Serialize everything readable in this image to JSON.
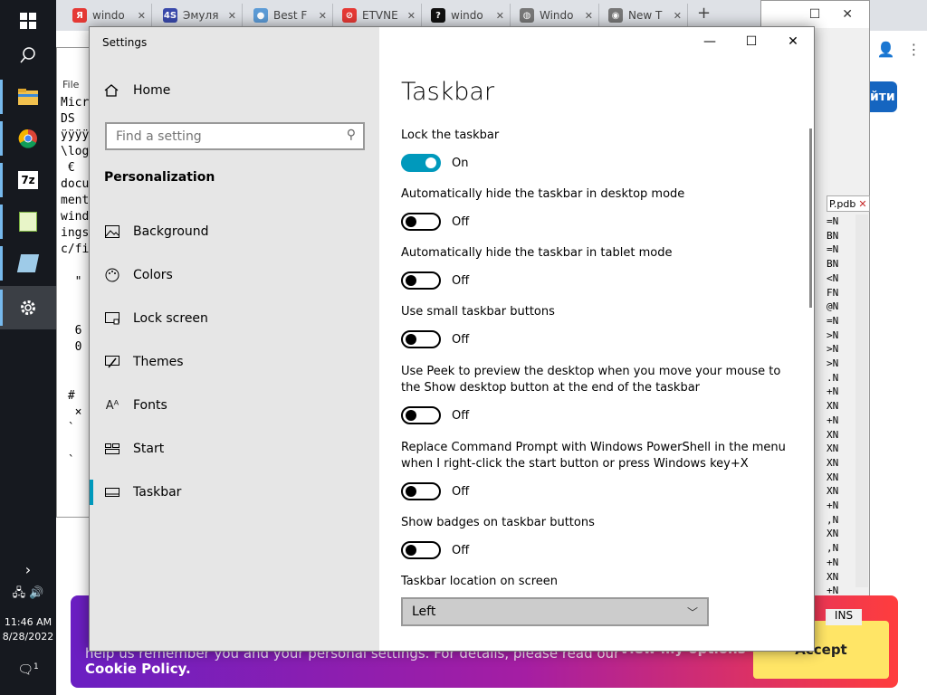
{
  "taskbar": {
    "time": "11:46 AM",
    "date": "8/28/2022",
    "notification_count": "1"
  },
  "browser": {
    "tabs": [
      {
        "label": "windo",
        "favicon": "Я",
        "color": "#e53935"
      },
      {
        "label": "Эмуля",
        "favicon": "4S",
        "color": "#3949ab"
      },
      {
        "label": "Best F",
        "favicon": "●",
        "color": "#5c9bd6"
      },
      {
        "label": "ETVNE",
        "favicon": "⊘",
        "color": "#e53935"
      },
      {
        "label": "windo",
        "favicon": "?",
        "color": "#111111"
      },
      {
        "label": "Windo",
        "favicon": "◍",
        "color": "#777777"
      },
      {
        "label": "New T",
        "favicon": "◉",
        "color": "#777777"
      }
    ],
    "new_tab": "+",
    "enter_button": "йти",
    "cookie": {
      "text": "help us remember you and your personal settings. For details, please read our",
      "link": "Cookie Policy.",
      "view_options": "View my options",
      "accept": "Accept"
    }
  },
  "notepad": {
    "menu": "File",
    "text_lines": [
      "Micr",
      "DS",
      "ÿÿÿÿ",
      "\\log",
      " €",
      "docu",
      "ment",
      "wind",
      "ings",
      "c/fi",
      "  ",
      "  \"",
      "",
      "  ",
      "  6",
      "  0",
      "",
      "  ",
      " #",
      "  ×",
      " `",
      "  ",
      " `"
    ]
  },
  "right_window": {
    "pdb_tab": "P.pdb",
    "hex_rows": [
      "=N",
      "BN",
      "=N",
      "BN",
      "<N",
      "FN",
      "@N",
      "=N",
      ">N",
      ">N",
      ">N",
      ".N",
      "+N",
      "XN",
      "+N",
      "XN",
      "XN",
      "XN",
      "XN",
      "XN",
      "+N",
      ",N",
      "XN",
      ",N",
      "+N",
      "XN",
      "+N"
    ],
    "status": "INS"
  },
  "settings": {
    "window_title": "Settings",
    "home": "Home",
    "search_placeholder": "Find a setting",
    "section": "Personalization",
    "nav": [
      {
        "label": "Background",
        "icon": "picture-icon"
      },
      {
        "label": "Colors",
        "icon": "palette-icon"
      },
      {
        "label": "Lock screen",
        "icon": "lock-screen-icon"
      },
      {
        "label": "Themes",
        "icon": "themes-icon"
      },
      {
        "label": "Fonts",
        "icon": "fonts-icon"
      },
      {
        "label": "Start",
        "icon": "start-icon"
      },
      {
        "label": "Taskbar",
        "icon": "taskbar-icon",
        "active": true
      }
    ],
    "page_title": "Taskbar",
    "options": [
      {
        "label": "Lock the taskbar",
        "state": "On",
        "on": true
      },
      {
        "label": "Automatically hide the taskbar in desktop mode",
        "state": "Off",
        "on": false
      },
      {
        "label": "Automatically hide the taskbar in tablet mode",
        "state": "Off",
        "on": false
      },
      {
        "label": "Use small taskbar buttons",
        "state": "Off",
        "on": false
      },
      {
        "label": "Use Peek to preview the desktop when you move your mouse to the Show desktop button at the end of the taskbar",
        "state": "Off",
        "on": false
      },
      {
        "label": "Replace Command Prompt with Windows PowerShell in the menu when I right-click the start button or press Windows key+X",
        "state": "Off",
        "on": false
      },
      {
        "label": "Show badges on taskbar buttons",
        "state": "Off",
        "on": false
      }
    ],
    "location_label": "Taskbar location on screen",
    "location_value": "Left",
    "accent_color": "#0099bc"
  }
}
